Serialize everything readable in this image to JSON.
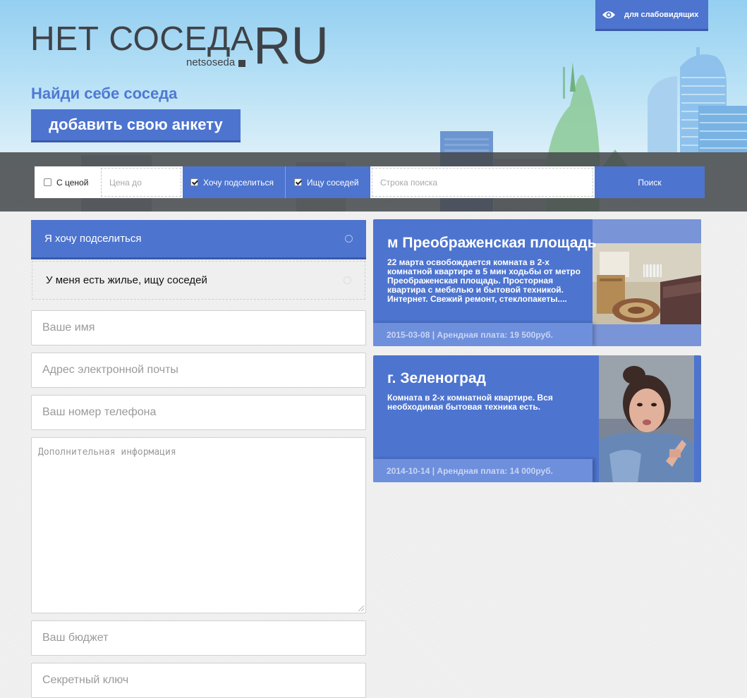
{
  "header": {
    "logo_text": "НЕТ СОСЕДА",
    "logo_suffix": "RU",
    "logo_subtitle": "netsoseda",
    "tagline": "Найди себе соседа",
    "add_profile_button": "добавить свою анкету",
    "accessibility_button": "для слабовидящих"
  },
  "search_bar": {
    "with_price_label": "С ценой",
    "with_price_checked": false,
    "price_placeholder": "Цена до",
    "want_share_label": "Хочу подселиться",
    "want_share_checked": true,
    "seek_neighbors_label": "Ищу соседей",
    "seek_neighbors_checked": true,
    "search_placeholder": "Строка поиска",
    "search_button": "Поиск"
  },
  "form": {
    "option_share": "Я хочу подселиться",
    "option_have_housing": "У меня есть жилье, ищу соседей",
    "fields": {
      "name": "Ваше имя",
      "email": "Адрес электронной почты",
      "phone": "Ваш номер телефона",
      "extra_info": "Дополнительная информация",
      "budget": "Ваш бюджет",
      "secret_key": "Секретный ключ"
    }
  },
  "listings": [
    {
      "title": "м Преображенская площадь",
      "description": "22 марта освобождается комната в 2-х комнатной квартире в 5 мин ходьбы от метро Преображенская площадь. Просторная квартира с мебелью и бытовой техникой. Интернет. Свежий ремонт, стеклопакеты....",
      "footer": "2015-03-08 | Арендная плата: 19 500руб."
    },
    {
      "title": "г. Зеленоград",
      "description": "Комната в 2-х комнатной квартире. Вся необходимая бытовая техника есть.",
      "footer": "2014-10-14 | Арендная плата: 14 000руб."
    }
  ],
  "colors": {
    "accent": "#4d74cf",
    "logo": "#3e4247",
    "search_band": "#46484b"
  }
}
